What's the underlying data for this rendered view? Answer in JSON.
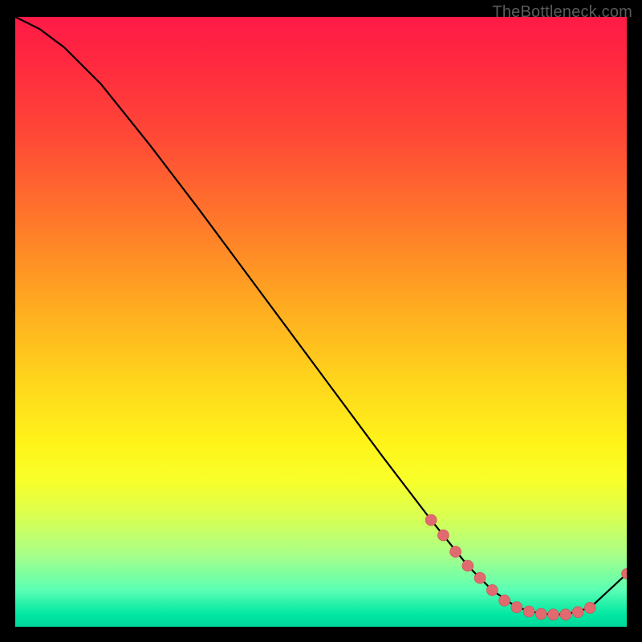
{
  "watermark": "TheBottleneck.com",
  "chart_data": {
    "type": "line",
    "title": "",
    "xlabel": "",
    "ylabel": "",
    "xlim": [
      0,
      100
    ],
    "ylim": [
      0,
      100
    ],
    "grid": false,
    "curve": {
      "name": "bottleneck-curve",
      "x": [
        0,
        4,
        8,
        14,
        22,
        30,
        40,
        50,
        60,
        68,
        74,
        78,
        82,
        86,
        90,
        94,
        100
      ],
      "y": [
        100,
        98,
        95,
        89,
        79,
        68.5,
        55,
        41.5,
        28,
        17.5,
        10,
        6,
        3.2,
        2.1,
        2.0,
        3.1,
        8.7
      ]
    },
    "highlight_segments": [
      {
        "name": "descending-highlight",
        "x": [
          68,
          70,
          72,
          74,
          76
        ],
        "y": [
          17.5,
          15,
          12.3,
          10,
          8.0
        ]
      },
      {
        "name": "valley-highlight",
        "x": [
          78,
          80,
          82,
          84,
          86,
          88,
          90,
          92,
          94
        ],
        "y": [
          6.0,
          4.3,
          3.2,
          2.5,
          2.1,
          2.0,
          2.0,
          2.4,
          3.1
        ]
      }
    ],
    "endpoint_marker": {
      "x": 100,
      "y": 8.7
    },
    "colors": {
      "curve": "#000000",
      "highlight": "#e06a6f",
      "highlight_stroke": "#c94f55",
      "gradient_top": "#ff1a47",
      "gradient_bottom": "#00d99b"
    }
  }
}
